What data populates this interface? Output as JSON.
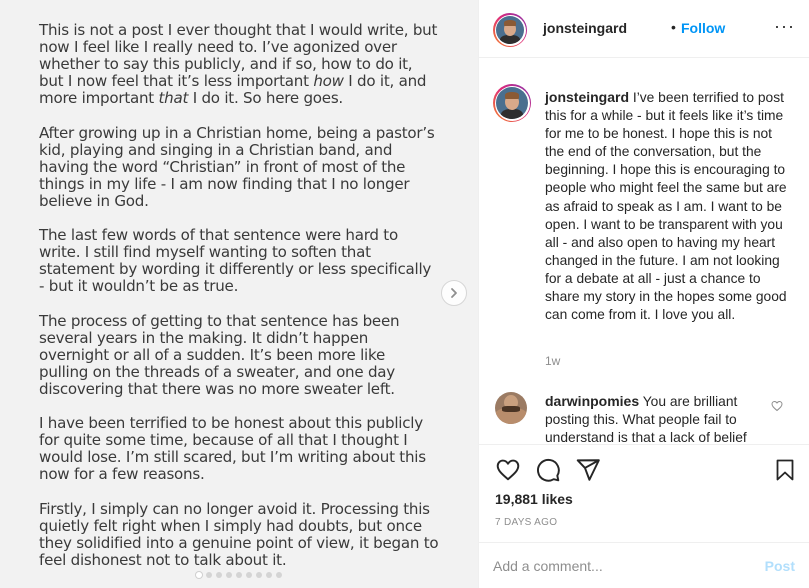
{
  "post_image": {
    "paragraphs": [
      [
        "This is not a post I ever thought that I would write, but",
        "now I feel like I really need to. I’ve agonized over",
        "whether to say this publicly, and if so, how to do it,",
        "but I now feel that it’s less important <em>how</em> I do it, and",
        "more important <em>that</em> I do it. So here goes."
      ],
      [
        "After growing up in a Christian home, being a pastor’s",
        "kid, playing and singing in a Christian band, and",
        "having the word “Christian” in front of most of the",
        "things in my life - I am now finding that I no longer",
        "believe in God."
      ],
      [
        "The last few words of that sentence were hard to",
        "write. I still find myself wanting to soften that",
        "statement by wording it differently or less specifically",
        "- but it wouldn’t be as true."
      ],
      [
        "The process of getting to that sentence has been",
        "several years in the making. It didn’t happen",
        "overnight or all of a sudden. It’s been more like",
        "pulling on the threads of a sweater, and one day",
        "discovering that there was no more sweater left."
      ],
      [
        "I have been terrified to be honest about this publicly",
        "for quite some time, because of all that I thought I",
        "would lose. I’m still scared, but I’m writing about this",
        "now for a few reasons."
      ],
      [
        "Firstly, I simply can no longer avoid it. Processing this",
        "quietly felt right when I simply had doubts, but once",
        "they solidified into a genuine point of view, it began to",
        "feel dishonest not to talk about it."
      ]
    ],
    "carousel_dots": 9,
    "active_dot": 0
  },
  "header": {
    "username": "jonsteingard",
    "separator": "•",
    "follow_label": "Follow",
    "more_label": "···"
  },
  "caption": {
    "username": "jonsteingard",
    "text": "I’ve been terrified to post this for a while - but it feels like it’s time for me to be honest. I hope this is not the end of the conversation, but the beginning. I hope this is encouraging to people who might feel the same but are as afraid to speak as I am. I want to be open. I want to be transparent with you all - and also open to having my heart changed in the future. I am not looking for a debate at all - just a chance to share my story in the hopes some good can come from it. I love you all.",
    "age": "1w"
  },
  "comments": [
    {
      "username": "darwinpomies",
      "text": "You are brilliant posting this. What people fail to understand is that a lack of belief"
    }
  ],
  "actions": {
    "likes": "19,881 likes",
    "date": "7 DAYS AGO"
  },
  "add_comment": {
    "placeholder": "Add a comment...",
    "post_label": "Post"
  },
  "colors": {
    "accent": "#0095f6",
    "post_disabled": "#b2dffc",
    "muted": "#8e8e8e",
    "text": "#262626",
    "image_bg": "#f2f2f2"
  },
  "icons": [
    "chevron-right-icon",
    "more-icon",
    "heart-icon",
    "comment-icon",
    "share-icon",
    "bookmark-icon"
  ]
}
